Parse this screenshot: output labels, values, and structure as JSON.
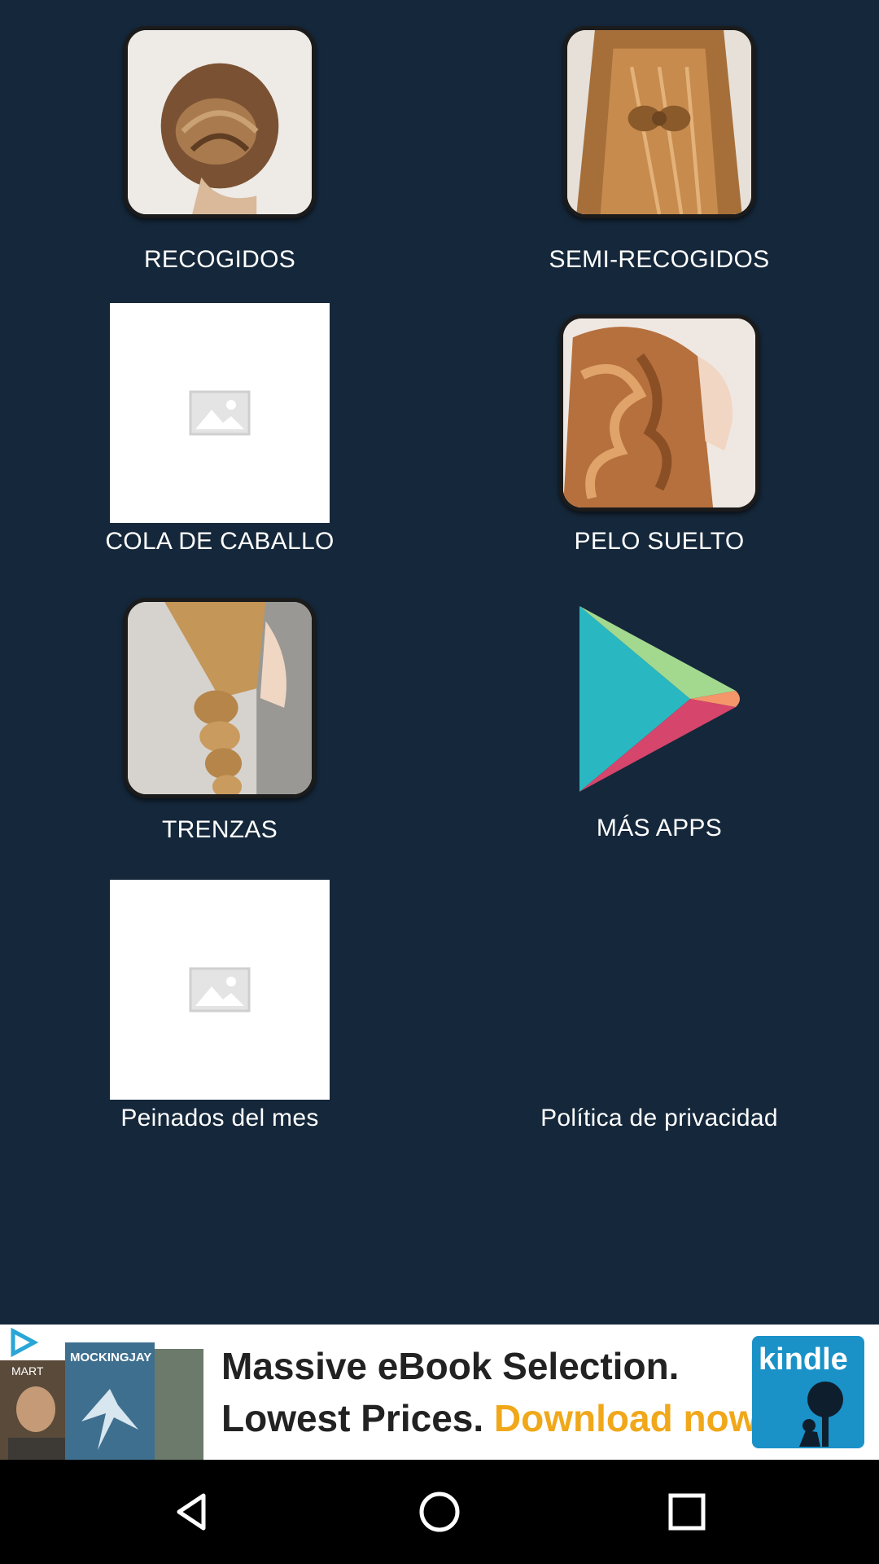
{
  "menu": {
    "items": [
      {
        "label": "RECOGIDOS"
      },
      {
        "label": "SEMI-RECOGIDOS"
      },
      {
        "label": "COLA DE CABALLO"
      },
      {
        "label": "PELO SUELTO"
      },
      {
        "label": "TRENZAS"
      },
      {
        "label": "MÁS APPS"
      },
      {
        "label": "Peinados del mes"
      },
      {
        "label": "Política de privacidad"
      }
    ]
  },
  "ad": {
    "book_title": "MOCKINGJAY",
    "headline": "Massive eBook Selection.",
    "subline": "Lowest Prices.",
    "cta": "Download now",
    "brand": "kindle"
  },
  "colors": {
    "background": "#15273a",
    "cta": "#f0a81a",
    "kindle_blue": "#1a92c8"
  }
}
